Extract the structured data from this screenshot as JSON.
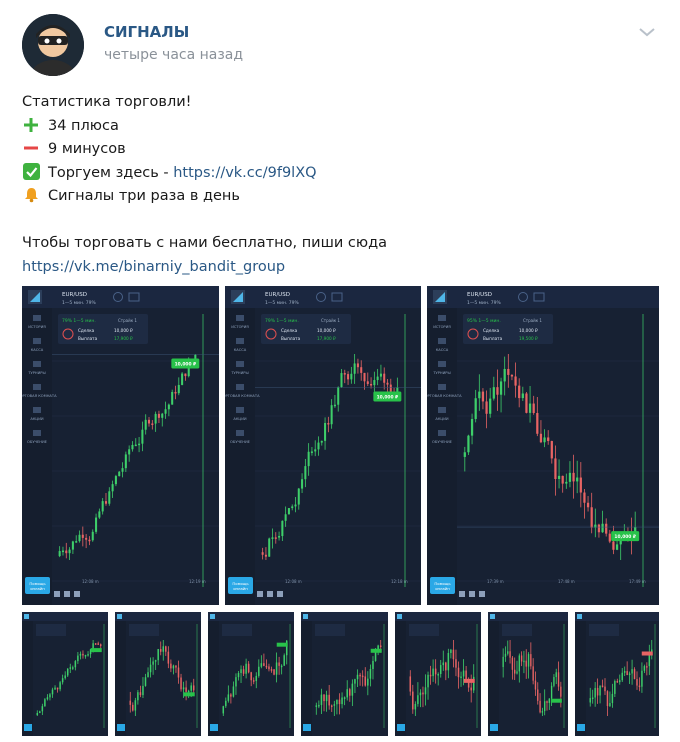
{
  "post": {
    "author": "СИГНАЛЫ",
    "time": "четыре часа назад",
    "lines": {
      "title": "Статистика торговли!",
      "plus": "34 плюса",
      "minus": "9 минусов",
      "trade_prefix": "Торгуем здесь - ",
      "trade_link": "https://vk.cc/9f9lXQ",
      "signals": "Сигналы три раза в день",
      "cta": "Чтобы торговать с нами бесплатно, пиши сюда",
      "cta_link": "https://vk.me/binarniy_bandit_group"
    },
    "icons": {
      "menu": "chevron-down-icon",
      "plus": "plus-icon",
      "minus": "minus-icon",
      "check": "check-icon",
      "bell": "bell-icon",
      "avatar": "bandit-avatar-icon"
    },
    "colors": {
      "link": "#2a5885",
      "plus": "#3fb23f",
      "minus": "#e64646",
      "check_bg": "#3fb23f",
      "bell": "#f0a020",
      "chart_bg": "#172133",
      "candle_up": "#3ecf6a",
      "candle_down": "#e86464",
      "badge": "#28c24a",
      "sidebar_btn": "#2aa8e6"
    }
  },
  "screenshots": {
    "large": [
      {
        "pair": "EUR/USD",
        "period": "1—5 мин.",
        "payout": "79%",
        "percent": "79%",
        "label_time": "1—5 мин.",
        "deal_label": "Сделка",
        "deal_value": "10,000 ₽",
        "payout_label": "Выплата",
        "payout_value": "17,900 ₽",
        "strike_label": "Страйк 1",
        "badge": "10,000 ₽",
        "times": [
          "12:08 m",
          "12:19 m"
        ],
        "trend": "up"
      },
      {
        "pair": "EUR/USD",
        "period": "1—5 мин.",
        "payout": "79%",
        "percent": "79%",
        "label_time": "1—5 мин.",
        "deal_label": "Сделка",
        "deal_value": "10,000 ₽",
        "payout_label": "Выплата",
        "payout_value": "17,900 ₽",
        "strike_label": "Страйк 1",
        "badge": "10,000 ₽",
        "times": [
          "12:08 m",
          "12:18 m"
        ],
        "trend": "upflat"
      },
      {
        "pair": "EUR/USD",
        "period": "1—5 мин.",
        "payout": "79%",
        "percent": "95%",
        "label_time": "1—5 мин.",
        "deal_label": "Сделка",
        "deal_value": "10,000 ₽",
        "payout_label": "Выплата",
        "payout_value": "19,500 ₽",
        "strike_label": "Страйк 1",
        "badge": "10,000 ₽",
        "times": [
          "17:39 m",
          "17:48 m",
          "17:49 m"
        ],
        "trend": "down"
      }
    ],
    "sidebar": {
      "items": [
        "ИСТОРИЯ",
        "КАССА",
        "ТУРНИРЫ",
        "ТОРГОВАЯ КОМНАТА",
        "АКЦИИ",
        "ОБУЧЕНИЕ"
      ],
      "bottom_button": [
        "Помощь",
        "онлайн"
      ]
    },
    "small_trends": [
      "up",
      "updown",
      "flatup",
      "volatile",
      "mixed",
      "mixed2",
      "mixed3"
    ]
  }
}
